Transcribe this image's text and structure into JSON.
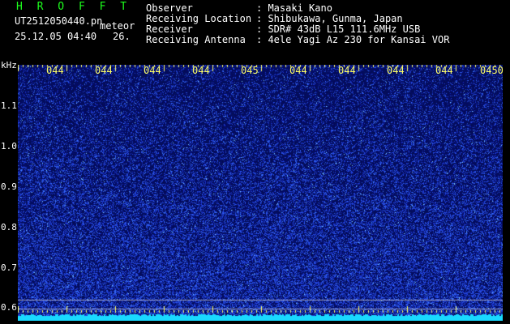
{
  "header": {
    "app_title": "H R O F F T",
    "file_name": "UT2512050440.pn",
    "category": "meteor",
    "datetime": "25.12.05 04:40",
    "extra": "26.",
    "info": [
      {
        "key": "Observer",
        "value": ": Masaki Kano"
      },
      {
        "key": "Receiving Location",
        "value": ": Shibukawa, Gunma, Japan"
      },
      {
        "key": "Receiver",
        "value": ": SDR# 43dB L15 111.6MHz USB"
      },
      {
        "key": "Receiving Antenna",
        "value": ": 4ele Yagi Az 230 for Kansai VOR"
      }
    ]
  },
  "spectrogram": {
    "unit": "kHz",
    "y_ticks": [
      "1.1",
      "1.0",
      "0.9",
      "0.8",
      "0.7",
      "0.6"
    ],
    "x_ticks": [
      "044",
      "044",
      "044",
      "044",
      "045",
      "044",
      "044",
      "044",
      "044",
      "0450"
    ],
    "colors": {
      "background": "#04095a",
      "noise": "#1e3cff",
      "bright": "#7fd8ff",
      "tick": "#ffff66",
      "baseline": "#19d9ff"
    }
  }
}
